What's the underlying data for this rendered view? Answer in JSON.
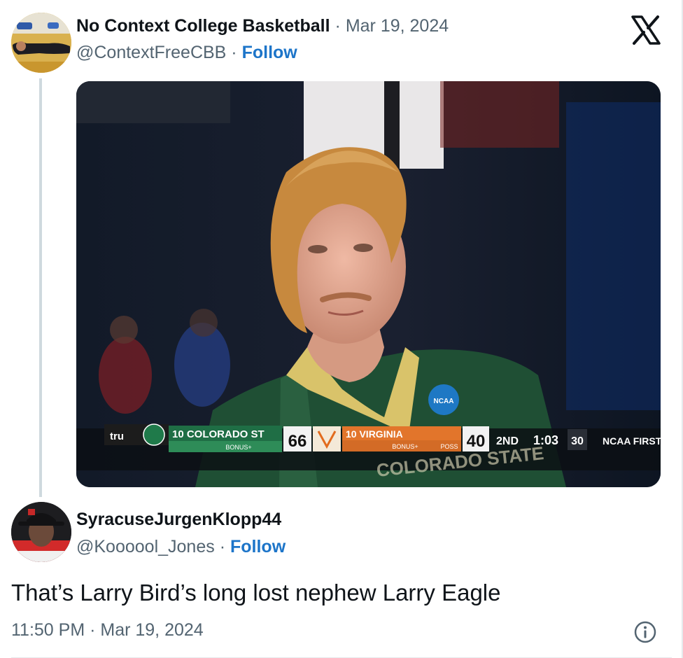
{
  "original_tweet": {
    "author_name": "No Context College Basketball",
    "date": "Mar 19, 2024",
    "separator": "·",
    "handle": "@ContextFreeCBB",
    "follow_label": "Follow"
  },
  "media": {
    "scoreboard": {
      "network": "tru",
      "team1": {
        "seed_name": "10 COLORADO ST",
        "bonus": "BONUS+",
        "score": "66"
      },
      "team2": {
        "seed_name": "10 VIRGINIA",
        "bonus": "BONUS+",
        "poss": "POSS",
        "score": "40"
      },
      "period": "2ND",
      "clock": "1:03",
      "shot_clock": "30",
      "ticker": "NCAA FIRST",
      "badge": "NCAA",
      "jersey_text": "COLORADO STATE"
    }
  },
  "reply": {
    "author_name": "SyracuseJurgenKlopp44",
    "handle": "@Koooool_Jones",
    "separator": "·",
    "follow_label": "Follow",
    "text": "That’s Larry Bird’s long lost nephew Larry Eagle",
    "timestamp": "11:50 PM · Mar 19, 2024"
  },
  "icons": {
    "logo": "x-logo-icon",
    "info": "info-icon"
  }
}
